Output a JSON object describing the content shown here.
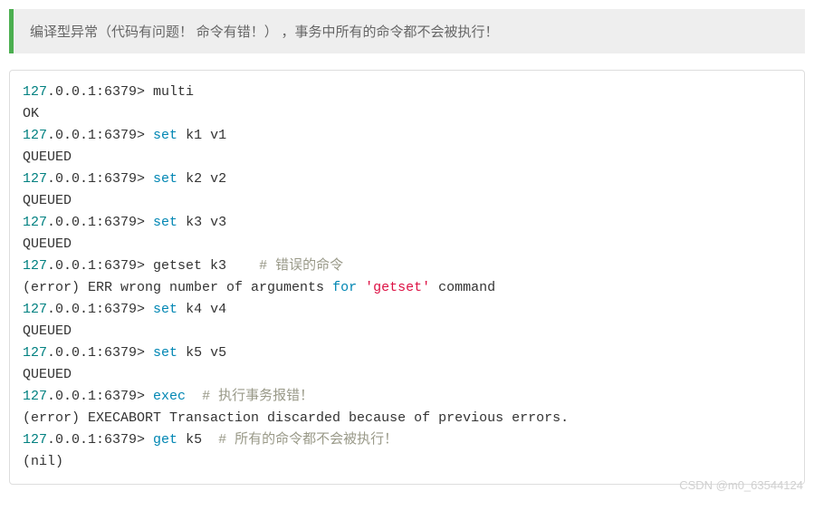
{
  "quote": {
    "text": "编译型异常（代码有问题！ 命令有错！） ，事务中所有的命令都不会被执行！"
  },
  "code": {
    "lines": [
      {
        "parts": [
          {
            "cls": "c-num",
            "t": "127"
          },
          {
            "t": ".0.0.1:6379> multi"
          }
        ]
      },
      {
        "parts": [
          {
            "t": "OK"
          }
        ]
      },
      {
        "parts": [
          {
            "cls": "c-num",
            "t": "127"
          },
          {
            "t": ".0.0.1:6379> "
          },
          {
            "cls": "c-cmd",
            "t": "set"
          },
          {
            "t": " k1 v1"
          }
        ]
      },
      {
        "parts": [
          {
            "t": "QUEUED"
          }
        ]
      },
      {
        "parts": [
          {
            "cls": "c-num",
            "t": "127"
          },
          {
            "t": ".0.0.1:6379> "
          },
          {
            "cls": "c-cmd",
            "t": "set"
          },
          {
            "t": " k2 v2"
          }
        ]
      },
      {
        "parts": [
          {
            "t": "QUEUED"
          }
        ]
      },
      {
        "parts": [
          {
            "cls": "c-num",
            "t": "127"
          },
          {
            "t": ".0.0.1:6379> "
          },
          {
            "cls": "c-cmd",
            "t": "set"
          },
          {
            "t": " k3 v3"
          }
        ]
      },
      {
        "parts": [
          {
            "t": "QUEUED"
          }
        ]
      },
      {
        "parts": [
          {
            "cls": "c-num",
            "t": "127"
          },
          {
            "t": ".0.0.1:6379> getset k3    "
          },
          {
            "cls": "c-com",
            "t": "# 错误的命令"
          }
        ]
      },
      {
        "parts": [
          {
            "t": "(error) ERR wrong number of arguments "
          },
          {
            "cls": "c-for",
            "t": "for"
          },
          {
            "t": " "
          },
          {
            "cls": "c-str",
            "t": "'getset'"
          },
          {
            "t": " command"
          }
        ]
      },
      {
        "parts": [
          {
            "cls": "c-num",
            "t": "127"
          },
          {
            "t": ".0.0.1:6379> "
          },
          {
            "cls": "c-cmd",
            "t": "set"
          },
          {
            "t": " k4 v4"
          }
        ]
      },
      {
        "parts": [
          {
            "t": "QUEUED"
          }
        ]
      },
      {
        "parts": [
          {
            "cls": "c-num",
            "t": "127"
          },
          {
            "t": ".0.0.1:6379> "
          },
          {
            "cls": "c-cmd",
            "t": "set"
          },
          {
            "t": " k5 v5"
          }
        ]
      },
      {
        "parts": [
          {
            "t": "QUEUED"
          }
        ]
      },
      {
        "parts": [
          {
            "cls": "c-num",
            "t": "127"
          },
          {
            "t": ".0.0.1:6379> "
          },
          {
            "cls": "c-kw",
            "t": "exec"
          },
          {
            "t": "  "
          },
          {
            "cls": "c-com",
            "t": "# 执行事务报错！"
          }
        ]
      },
      {
        "parts": [
          {
            "t": "(error) EXECABORT Transaction discarded because of previous errors."
          }
        ]
      },
      {
        "parts": [
          {
            "cls": "c-num",
            "t": "127"
          },
          {
            "t": ".0.0.1:6379> "
          },
          {
            "cls": "c-kw",
            "t": "get"
          },
          {
            "t": " k5  "
          },
          {
            "cls": "c-com",
            "t": "# 所有的命令都不会被执行！"
          }
        ]
      },
      {
        "parts": [
          {
            "t": "(nil)"
          }
        ]
      }
    ]
  },
  "watermark": "CSDN @m0_63544124"
}
